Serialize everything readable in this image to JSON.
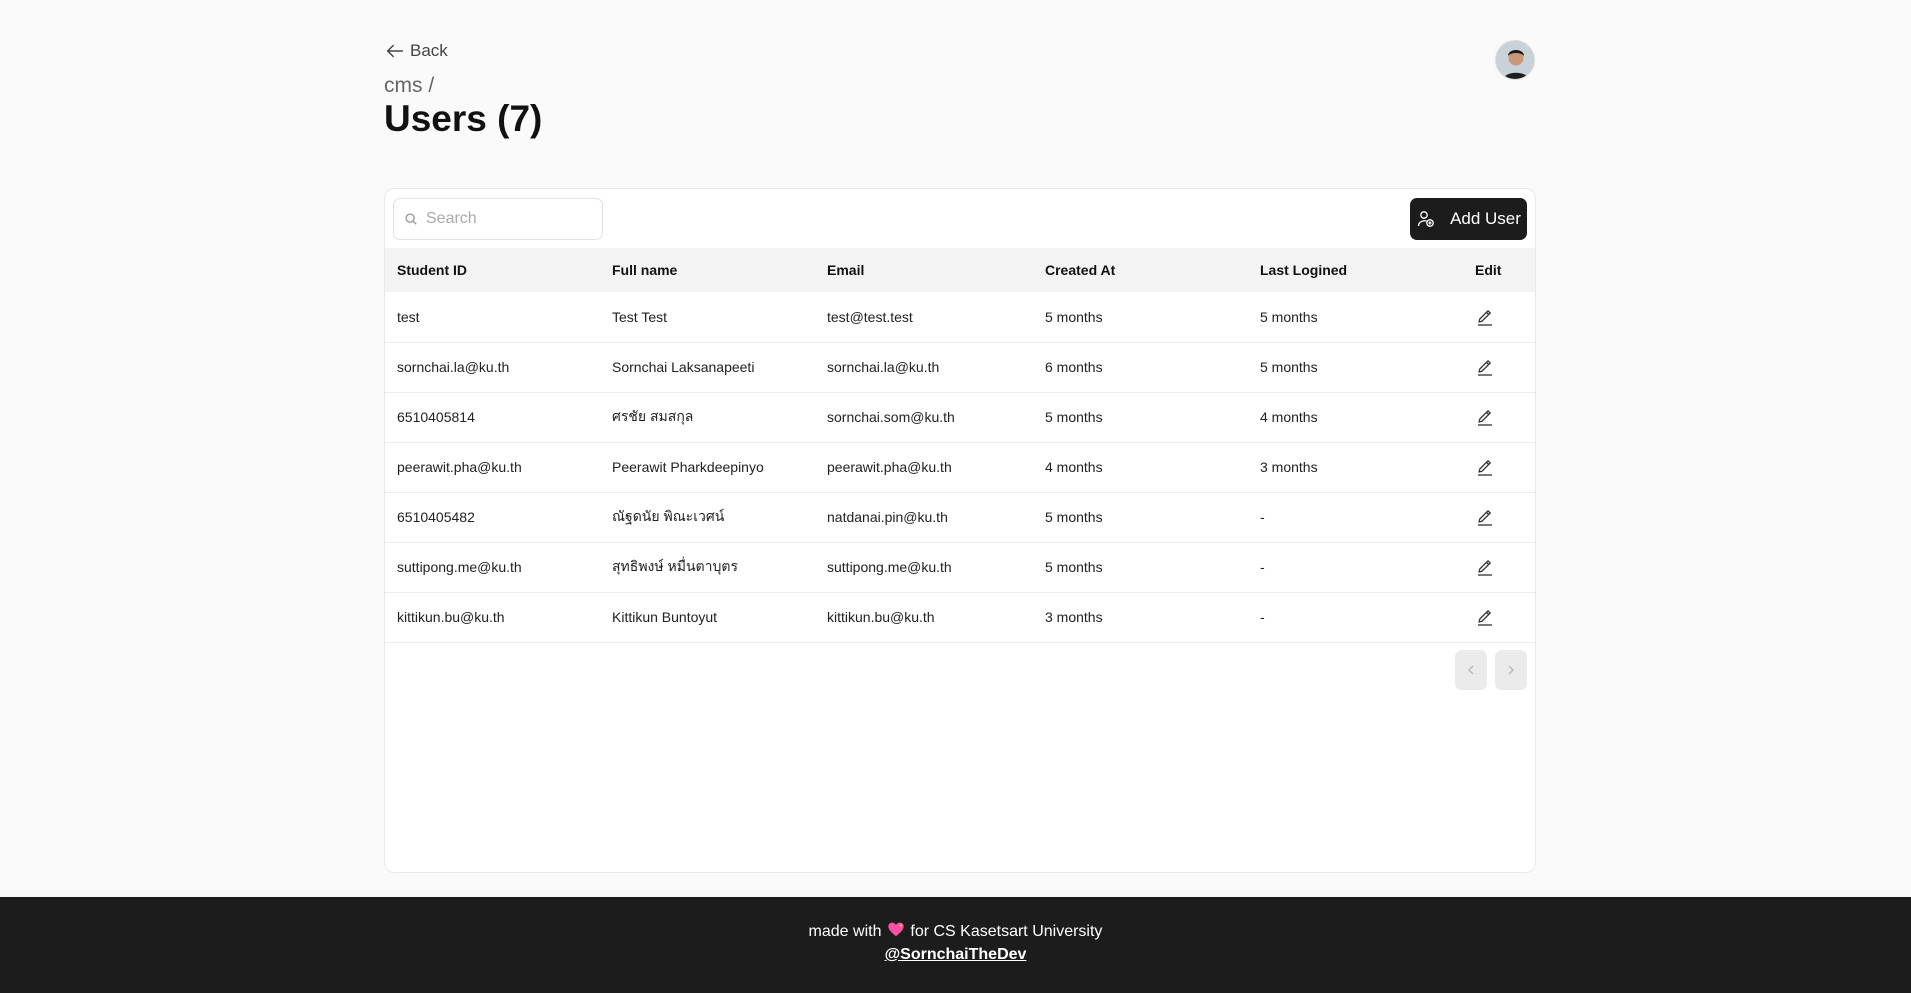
{
  "nav": {
    "back_label": "Back"
  },
  "breadcrumb": "cms /",
  "page_title": "Users (7)",
  "search": {
    "placeholder": "Search",
    "value": ""
  },
  "toolbar": {
    "add_user_label": "Add User"
  },
  "table": {
    "columns": [
      "Student ID",
      "Full name",
      "Email",
      "Created At",
      "Last Logined",
      "Edit"
    ],
    "rows": [
      [
        "test",
        "Test Test",
        "test@test.test",
        "5 months",
        "5 months"
      ],
      [
        "sornchai.la@ku.th",
        "Sornchai Laksanapeeti",
        "sornchai.la@ku.th",
        "6 months",
        "5 months"
      ],
      [
        "6510405814",
        "ศรชัย สมสกุล",
        "sornchai.som@ku.th",
        "5 months",
        "4 months"
      ],
      [
        "peerawit.pha@ku.th",
        "Peerawit Pharkdeepinyo",
        "peerawit.pha@ku.th",
        "4 months",
        "3 months"
      ],
      [
        "6510405482",
        "ณัฐดนัย พิณะเวศน์",
        "natdanai.pin@ku.th",
        "5 months",
        "-"
      ],
      [
        "suttipong.me@ku.th",
        "สุทธิพงษ์ หมื่นตาบุตร",
        "suttipong.me@ku.th",
        "5 months",
        "-"
      ],
      [
        "kittikun.bu@ku.th",
        "Kittikun Buntoyut",
        "kittikun.bu@ku.th",
        "3 months",
        "-"
      ]
    ]
  },
  "pagination": {
    "prev_icon": "chevron-left-icon",
    "next_icon": "chevron-right-icon"
  },
  "footer": {
    "text_before": "made with",
    "heart_icon": "sparkling-heart-icon",
    "text_after": "for CS Kasetsart University",
    "handle": "@SornchaiTheDev"
  },
  "colors": {
    "primary": "#1c1c1c",
    "background": "#fafafa",
    "footer_bg": "#1c1c1c",
    "heart": "#ff4fa0"
  }
}
